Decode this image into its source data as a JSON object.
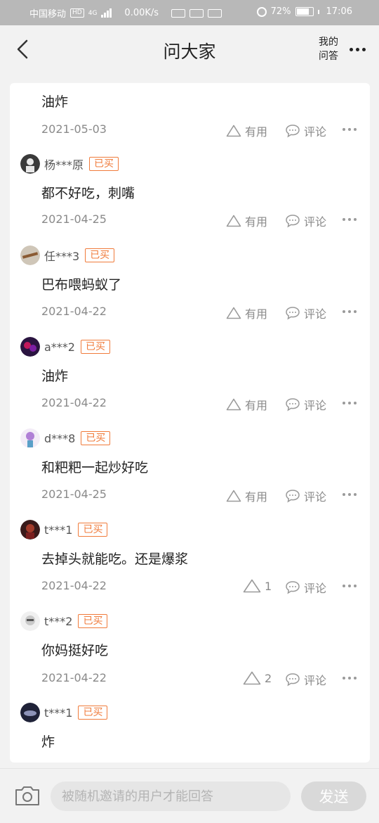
{
  "status_bar": {
    "carrier": "中国移动",
    "network_type": "HD",
    "signal_type": "4G",
    "speed": "0.00K/s",
    "battery": "72%",
    "time": "17:06"
  },
  "header": {
    "title": "问大家",
    "my_qa_label": "我的问答"
  },
  "answers": [
    {
      "text": "油炸",
      "date": "2021-05-03",
      "useful": "有用",
      "comment": "评论"
    },
    {
      "user": "杨***原",
      "badge": "已买",
      "text": "都不好吃，刺嘴",
      "date": "2021-04-25",
      "useful": "有用",
      "comment": "评论",
      "avatar_color": "#3a3a3a"
    },
    {
      "user": "任***3",
      "badge": "已买",
      "text": "巴布喂蚂蚁了",
      "date": "2021-04-22",
      "useful": "有用",
      "comment": "评论",
      "avatar_color": "#8a7a66"
    },
    {
      "user": "a***2",
      "badge": "已买",
      "text": "油炸",
      "date": "2021-04-22",
      "useful": "有用",
      "comment": "评论",
      "avatar_color": "#5a2d6e"
    },
    {
      "user": "d***8",
      "badge": "已买",
      "text": "和粑粑一起炒好吃",
      "date": "2021-04-25",
      "useful": "有用",
      "comment": "评论",
      "avatar_color": "#b07fd6"
    },
    {
      "user": "t***1",
      "badge": "已买",
      "text": "去掉头就能吃。还是爆浆",
      "date": "2021-04-22",
      "useful": "1",
      "comment": "评论",
      "avatar_color": "#6b1f1f"
    },
    {
      "user": "t***2",
      "badge": "已买",
      "text": "你妈挺好吃",
      "date": "2021-04-22",
      "useful": "2",
      "comment": "评论",
      "avatar_color": "#c9c9c9"
    },
    {
      "user": "t***1",
      "badge": "已买",
      "text": "炸",
      "avatar_color": "#2b2e4a"
    }
  ],
  "bottom_bar": {
    "input_placeholder": "被随机邀请的用户才能回答",
    "send_label": "发送"
  },
  "colors": {
    "badge": "#f07b3b",
    "meta_text": "#8a8a8a",
    "background": "#f2f2f2"
  },
  "icons": [
    "back-icon",
    "more-icon",
    "thumbs-up-triangle-icon",
    "comment-bubble-icon",
    "camera-icon"
  ]
}
